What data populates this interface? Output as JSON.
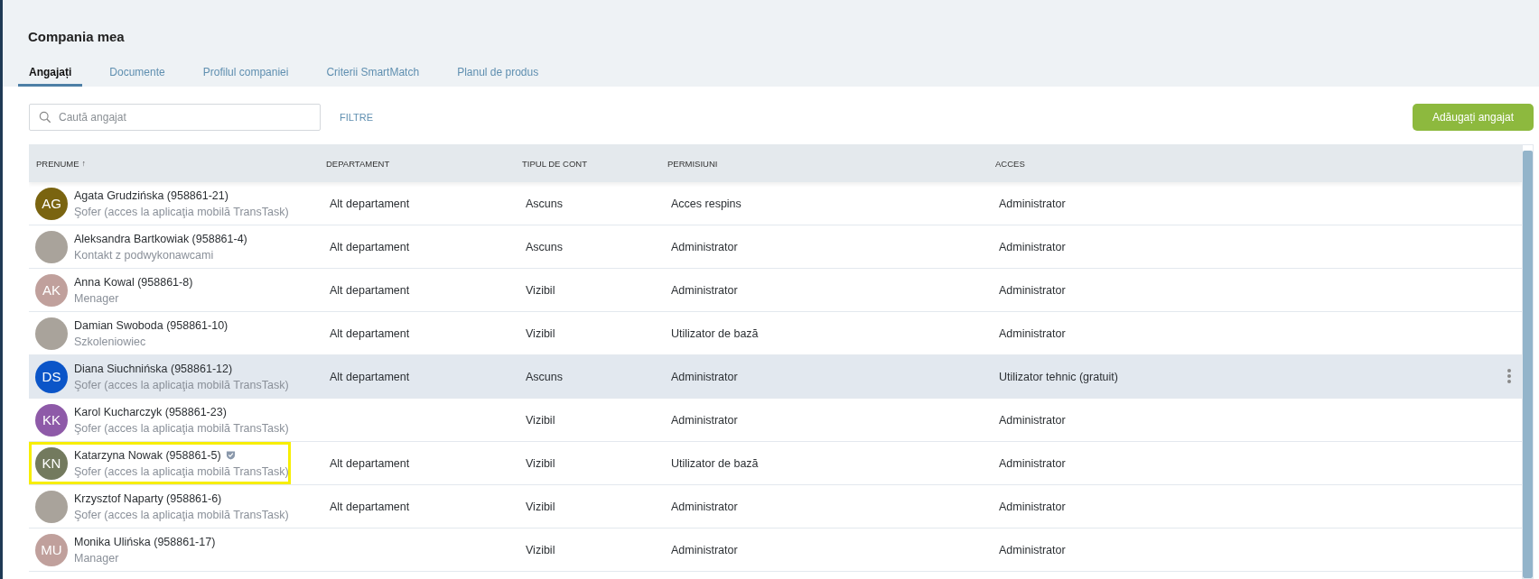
{
  "page_title": "Compania mea",
  "tabs": [
    {
      "label": "Angajați",
      "selected": true
    },
    {
      "label": "Documente",
      "selected": false
    },
    {
      "label": "Profilul companiei",
      "selected": false
    },
    {
      "label": "Criterii SmartMatch",
      "selected": false
    },
    {
      "label": "Planul de produs",
      "selected": false
    }
  ],
  "search": {
    "placeholder": "Caută angajat"
  },
  "filters_link": "FILTRE",
  "add_button": "Adăugați angajat",
  "table": {
    "columns": [
      {
        "label": "PRENUME",
        "sort_mark": "↑"
      },
      {
        "label": "DEPARTAMENT"
      },
      {
        "label": "TIPUL DE CONT"
      },
      {
        "label": "PERMISIUNI"
      },
      {
        "label": "ACCES"
      }
    ],
    "rows": [
      {
        "avatar": {
          "kind": "initials",
          "initials": "AG",
          "color": "#7a6410"
        },
        "name": "Agata Grudzińska (958861-21)",
        "role": "Şofer (acces la aplicaţia mobilă TransTask)",
        "verified": false,
        "department": "Alt departament",
        "account_type": "Ascuns",
        "permissions": "Acces respins",
        "access": "Administrator",
        "hovered": false,
        "outlined": false
      },
      {
        "avatar": {
          "kind": "photo"
        },
        "name": "Aleksandra Bartkowiak (958861-4)",
        "role": "Kontakt z podwykonawcami",
        "verified": false,
        "department": "Alt departament",
        "account_type": "Ascuns",
        "permissions": "Administrator",
        "access": "Administrator",
        "hovered": false,
        "outlined": false
      },
      {
        "avatar": {
          "kind": "initials",
          "initials": "AK",
          "color": "#c0a09c"
        },
        "name": "Anna Kowal (958861-8)",
        "role": "Menager",
        "verified": false,
        "department": "Alt departament",
        "account_type": "Vizibil",
        "permissions": "Administrator",
        "access": "Administrator",
        "hovered": false,
        "outlined": false
      },
      {
        "avatar": {
          "kind": "photo"
        },
        "name": "Damian Swoboda (958861-10)",
        "role": "Szkoleniowiec",
        "verified": false,
        "department": "Alt departament",
        "account_type": "Vizibil",
        "permissions": "Utilizator de bază",
        "access": "Administrator",
        "hovered": false,
        "outlined": false
      },
      {
        "avatar": {
          "kind": "initials",
          "initials": "DS",
          "color": "#0b55c8"
        },
        "name": "Diana Siuchnińska (958861-12)",
        "role": "Şofer (acces la aplicaţia mobilă TransTask)",
        "verified": false,
        "department": "Alt departament",
        "account_type": "Ascuns",
        "permissions": "Administrator",
        "access": "Utilizator tehnic (gratuit)",
        "hovered": true,
        "outlined": false
      },
      {
        "avatar": {
          "kind": "initials",
          "initials": "KK",
          "color": "#8e5aa8"
        },
        "name": "Karol Kucharczyk (958861-23)",
        "role": "Şofer (acces la aplicaţia mobilă TransTask)",
        "verified": false,
        "department": "",
        "account_type": "Vizibil",
        "permissions": "Administrator",
        "access": "Administrator",
        "hovered": false,
        "outlined": false
      },
      {
        "avatar": {
          "kind": "initials",
          "initials": "KN",
          "color": "#737a5e"
        },
        "name": "Katarzyna Nowak (958861-5)",
        "role": "Şofer (acces la aplicaţia mobilă TransTask)",
        "verified": true,
        "department": "Alt departament",
        "account_type": "Vizibil",
        "permissions": "Utilizator de bază",
        "access": "Administrator",
        "hovered": false,
        "outlined": true
      },
      {
        "avatar": {
          "kind": "photo"
        },
        "name": "Krzysztof Naparty (958861-6)",
        "role": "Şofer (acces la aplicaţia mobilă TransTask)",
        "verified": false,
        "department": "Alt departament",
        "account_type": "Vizibil",
        "permissions": "Administrator",
        "access": "Administrator",
        "hovered": false,
        "outlined": false
      },
      {
        "avatar": {
          "kind": "initials",
          "initials": "MU",
          "color": "#c0a09c"
        },
        "name": "Monika Ulińska (958861-17)",
        "role": "Manager",
        "verified": false,
        "department": "",
        "account_type": "Vizibil",
        "permissions": "Administrator",
        "access": "Administrator",
        "hovered": false,
        "outlined": false
      }
    ]
  }
}
